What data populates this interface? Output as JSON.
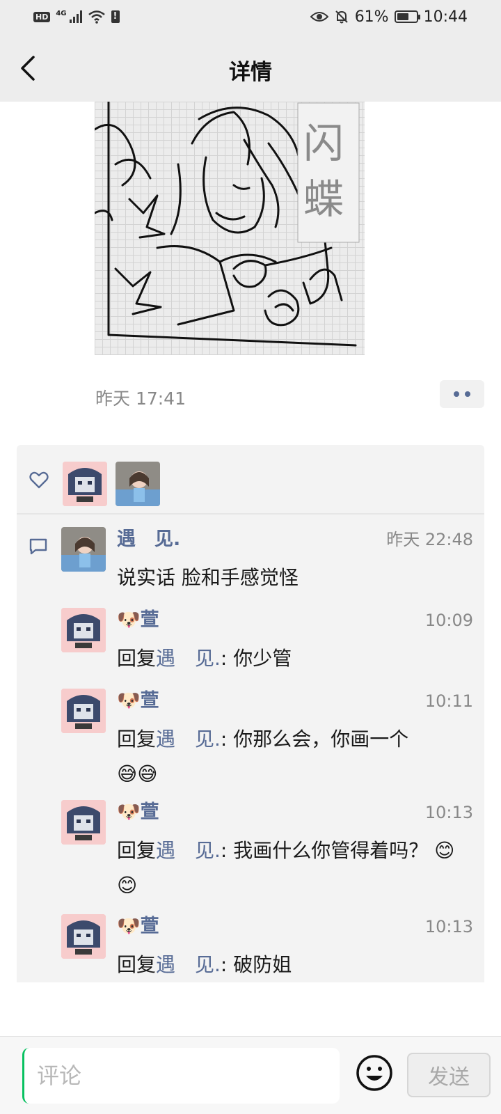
{
  "status_bar": {
    "hd_label": "HD",
    "network": "4G",
    "battery_level": "61%",
    "battery_fraction": 0.61,
    "time": "10:44"
  },
  "header": {
    "title": "详情",
    "back_icon": "chevron-left-icon"
  },
  "post": {
    "image_icon": "drawing-image",
    "time": "昨天 17:41",
    "more_icon": "more-dots-icon"
  },
  "likes": {
    "icon": "heart-icon",
    "avatars": [
      "anime-avatar",
      "photo-avatar"
    ]
  },
  "comments": [
    {
      "avatar": "photo-avatar",
      "name": "遇　见.",
      "time": "昨天 22:48",
      "reply_prefix": "",
      "reply_to": "",
      "text": "说实话 脸和手感觉怪",
      "emojis": ""
    },
    {
      "avatar": "anime-avatar",
      "name": "🐶萱",
      "time": "10:09",
      "reply_prefix": "回复",
      "reply_to": "遇　见.",
      "text": ": 你少管",
      "emojis": ""
    },
    {
      "avatar": "anime-avatar",
      "name": "🐶萱",
      "time": "10:11",
      "reply_prefix": "回复",
      "reply_to": "遇　见.",
      "text": ": 你那么会，你画一个",
      "emojis": "😅😅"
    },
    {
      "avatar": "anime-avatar",
      "name": "🐶萱",
      "time": "10:13",
      "reply_prefix": "回复",
      "reply_to": "遇　见.",
      "text": ": 我画什么你管得着吗？",
      "emojis": "😊😊"
    },
    {
      "avatar": "anime-avatar",
      "name": "🐶萱",
      "time": "10:13",
      "reply_prefix": "回复",
      "reply_to": "遇　见.",
      "text": ": 破防姐",
      "emojis": ""
    }
  ],
  "comment_icon": "comment-icon",
  "bottom_bar": {
    "input_placeholder": "评论",
    "emoji_icon": "smiley-icon",
    "send_label": "发送"
  },
  "colors": {
    "link": "#576b95",
    "bar_bg": "#ededed",
    "panel_bg": "#f3f3f3",
    "accent_cursor": "#07c160"
  }
}
